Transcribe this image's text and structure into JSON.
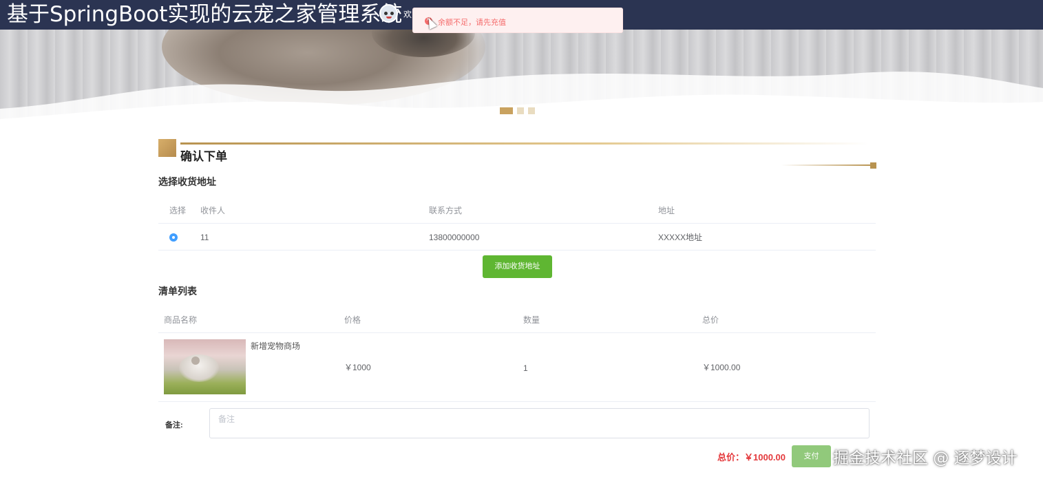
{
  "header": {
    "site_title": "基于SpringBoot实现的云宠之家管理系统",
    "welcome_text": "欢"
  },
  "toast": {
    "message": "余额不足，请先充值",
    "icon": "error-circle-icon",
    "color": "#f56c6c"
  },
  "banner": {
    "carousel_active_index": 0,
    "carousel_count": 3
  },
  "section": {
    "title": "确认下单"
  },
  "address": {
    "title": "选择收货地址",
    "columns": [
      "选择",
      "收件人",
      "联系方式",
      "地址"
    ],
    "rows": [
      {
        "selected": true,
        "recipient": "11",
        "phone": "13800000000",
        "address": "XXXXX地址"
      }
    ],
    "add_button": "添加收货地址"
  },
  "order": {
    "title": "清单列表",
    "columns": [
      "商品名称",
      "价格",
      "数量",
      "总价"
    ],
    "rows": [
      {
        "name": "新增宠物商场",
        "price": "￥1000",
        "quantity": "1",
        "total": "￥1000.00"
      }
    ]
  },
  "remark": {
    "label": "备注:",
    "placeholder": "备注"
  },
  "footer": {
    "total_label": "总价：￥1000.00",
    "pay_button": "支付"
  },
  "watermark": "掘金技术社区 @ 逐梦设计",
  "colors": {
    "header_bg": "#2b3452",
    "accent_gold": "#c9a25f",
    "button_green": "#5fb632",
    "price_red": "#e4393c"
  }
}
